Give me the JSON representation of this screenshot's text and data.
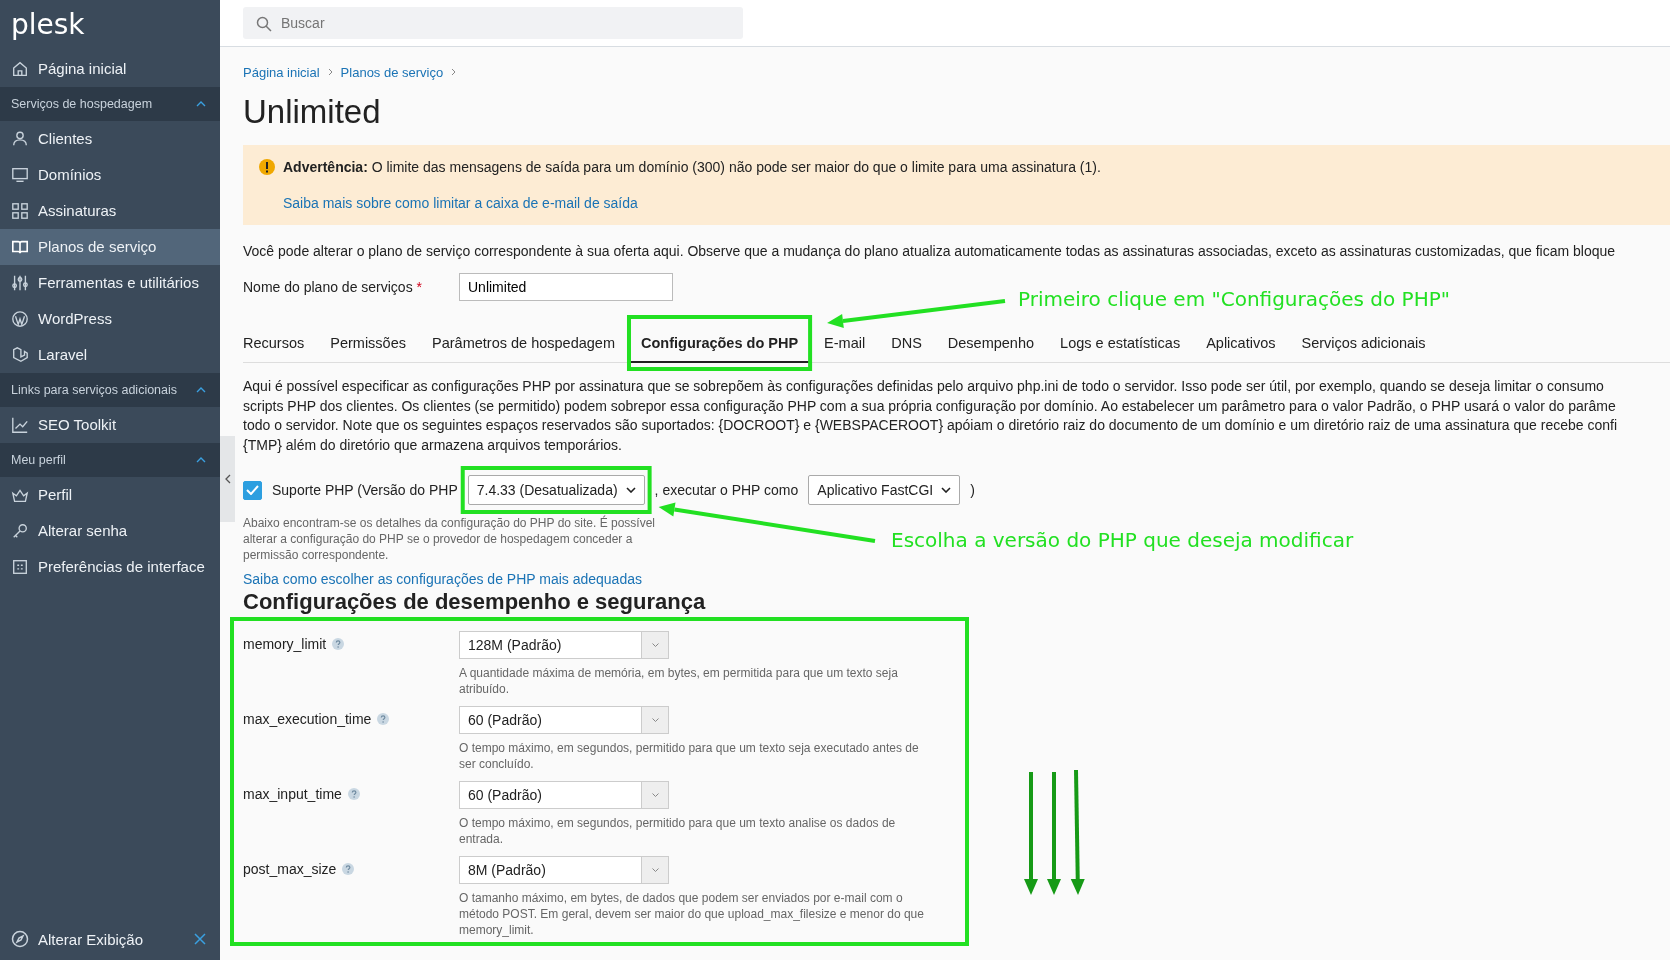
{
  "sidebar": {
    "logo": "plesk",
    "sections": [
      {
        "items": [
          {
            "label": "Página inicial",
            "selected": false
          }
        ]
      },
      {
        "header": "Serviços de hospedagem",
        "expanded": true,
        "items": [
          {
            "label": "Clientes",
            "selected": false
          },
          {
            "label": "Domínios",
            "selected": false
          },
          {
            "label": "Assinaturas",
            "selected": false
          },
          {
            "label": "Planos de serviço",
            "selected": true
          },
          {
            "label": "Ferramentas e utilitários",
            "selected": false
          },
          {
            "label": "WordPress",
            "selected": false
          },
          {
            "label": "Laravel",
            "selected": false
          }
        ]
      },
      {
        "header": "Links para serviços adicionais",
        "expanded": true,
        "items": [
          {
            "label": "SEO Toolkit",
            "selected": false
          }
        ]
      },
      {
        "header": "Meu perfil",
        "expanded": true,
        "items": [
          {
            "label": "Perfil",
            "selected": false
          },
          {
            "label": "Alterar senha",
            "selected": false
          },
          {
            "label": "Preferências de interface",
            "selected": false
          }
        ]
      }
    ],
    "footer": {
      "label": "Alterar Exibição"
    }
  },
  "search": {
    "placeholder": "Buscar"
  },
  "breadcrumbs": [
    "Página inicial",
    "Planos de serviço"
  ],
  "title": "Unlimited",
  "warning": {
    "label": "Advertência:",
    "text": "O limite das mensagens de saída para um domínio (300) não pode ser maior do que o limite para uma assinatura (1).",
    "link": "Saiba mais sobre como limitar a caixa de e-mail de saída"
  },
  "intro": "Você pode alterar o plano de serviço correspondente à sua oferta aqui. Observe que a mudança do plano atualiza automaticamente todas as assinaturas associadas, exceto as assinaturas customizadas, que ficam bloque",
  "plan_name": {
    "label": "Nome do plano de serviços",
    "required": "*",
    "value": "Unlimited"
  },
  "tabs": [
    {
      "label": "Recursos",
      "selected": false
    },
    {
      "label": "Permissões",
      "selected": false
    },
    {
      "label": "Parâmetros de hospedagem",
      "selected": false
    },
    {
      "label": "Configurações do PHP",
      "selected": true
    },
    {
      "label": "E-mail",
      "selected": false
    },
    {
      "label": "DNS",
      "selected": false
    },
    {
      "label": "Desempenho",
      "selected": false
    },
    {
      "label": "Logs e estatísticas",
      "selected": false
    },
    {
      "label": "Aplicativos",
      "selected": false
    },
    {
      "label": "Serviços adicionais",
      "selected": false
    }
  ],
  "description_lines": [
    "Aqui é possível especificar as configurações PHP por assinatura que se sobrepõem às configurações definidas pelo arquivo php.ini de todo o servidor. Isso pode ser útil, por exemplo, quando se deseja limitar o consumo",
    "scripts PHP dos clientes. Os clientes (se permitido) podem sobrepor essa configuração PHP com a sua própria configuração por domínio. Ao estabelecer um parâmetro para o valor Padrão, o PHP usará o valor do parâme",
    "todo o servidor. Note que os seguintes espaços reservados são suportados: {DOCROOT} e {WEBSPACEROOT} apóiam o diretório raiz do documento de um domínio e um diretório raiz de uma assinatura que recebe confi",
    "{TMP} além do diretório que armazena arquivos temporários."
  ],
  "php_support": {
    "checked": true,
    "label": "Suporte PHP (Versão do PHP",
    "version": "7.4.33 (Desatualizada)",
    "middle": ", executar o PHP como",
    "handler": "Aplicativo FastCGI",
    "end": ")",
    "hint": "Abaixo encontram-se os detalhes da configuração do PHP do site. É possível alterar a configuração do PHP se o provedor de hospedagem conceder a permissão correspondente."
  },
  "settings_link": "Saiba como escolher as configurações de PHP mais adequadas",
  "settings_heading": "Configurações de desempenho e segurança",
  "settings": [
    {
      "name": "memory_limit",
      "value": "128M (Padrão)",
      "description": "A quantidade máxima de memória, em bytes, em permitida para que um texto seja atribuído."
    },
    {
      "name": "max_execution_time",
      "value": "60 (Padrão)",
      "description": "O tempo máximo, em segundos, permitido para que um texto seja executado antes de ser concluído."
    },
    {
      "name": "max_input_time",
      "value": "60 (Padrão)",
      "description": "O tempo máximo, em segundos, permitido para que um texto analise os dados de entrada."
    },
    {
      "name": "post_max_size",
      "value": "8M (Padrão)",
      "description": "O tamanho máximo, em bytes, de dados que podem ser enviados por e-mail com o método POST. Em geral, devem ser maior do que upload_max_filesize e menor do que memory_limit."
    }
  ],
  "annotations": [
    "Primeiro clique em \"Configurações do PHP\"",
    "Escolha a versão do PHP que deseja modificar"
  ]
}
